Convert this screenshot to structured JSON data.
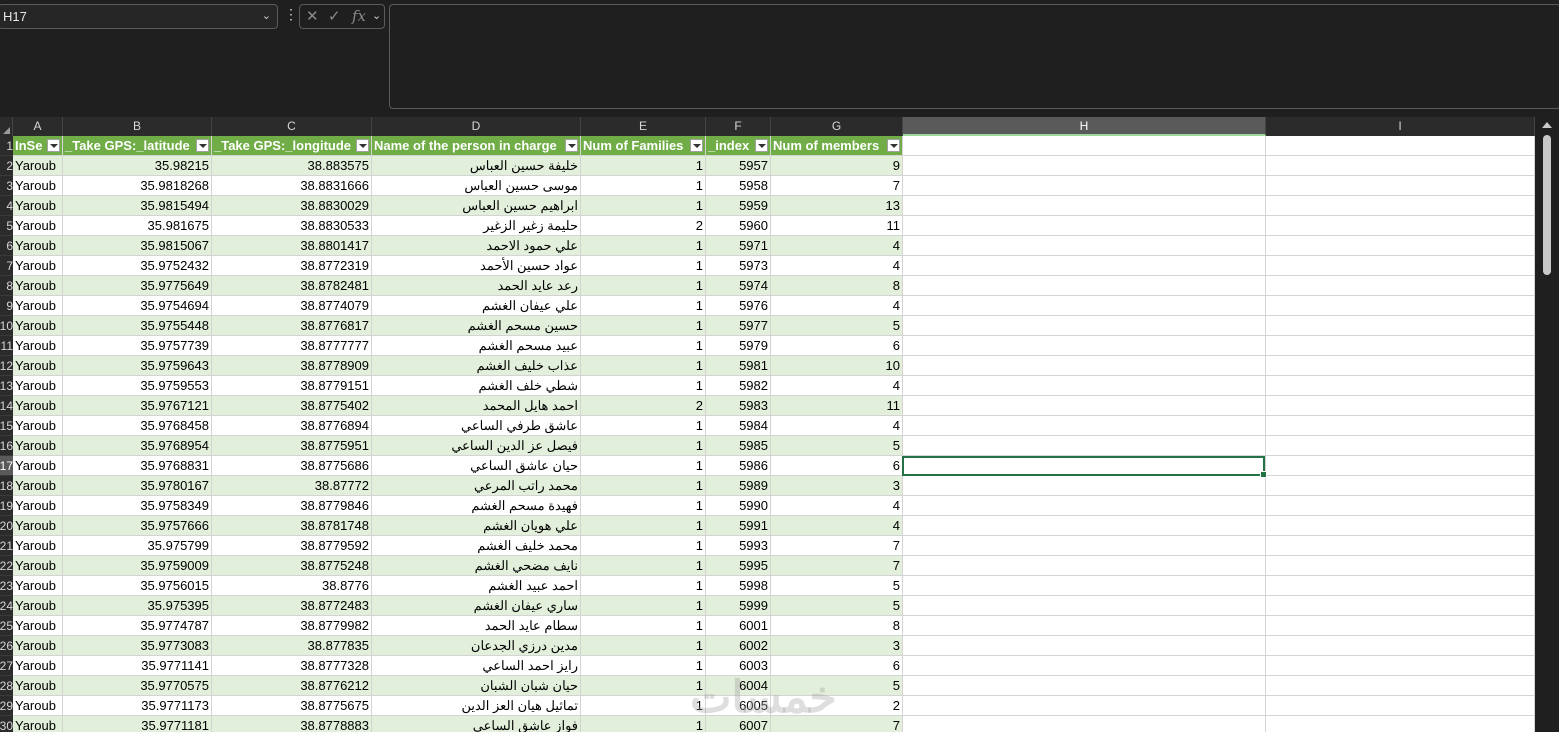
{
  "formula_bar": {
    "name_box": "H17",
    "fx_label": "fx",
    "formula": ""
  },
  "columns": [
    {
      "letter": "A",
      "w": 50
    },
    {
      "letter": "B",
      "w": 149
    },
    {
      "letter": "C",
      "w": 160
    },
    {
      "letter": "D",
      "w": 209
    },
    {
      "letter": "E",
      "w": 125
    },
    {
      "letter": "F",
      "w": 65
    },
    {
      "letter": "G",
      "w": 132
    },
    {
      "letter": "H",
      "w": 363
    },
    {
      "letter": "I",
      "w": 269
    }
  ],
  "selected_column": "H",
  "selected_row": "17",
  "headers": [
    "InSe",
    "_Take GPS:_latitude",
    "_Take GPS:_longitude",
    "Name of the person in charge",
    "Num of Families",
    "_index",
    "Num of members"
  ],
  "rows": [
    {
      "r": "1"
    },
    {
      "r": "2",
      "A": "Yaroub",
      "B": "35.98215",
      "C": "38.883575",
      "D": "خليفة حسين العباس",
      "E": "1",
      "F": "5957",
      "G": "9"
    },
    {
      "r": "3",
      "A": "Yaroub",
      "B": "35.9818268",
      "C": "38.8831666",
      "D": "موسى حسين العباس",
      "E": "1",
      "F": "5958",
      "G": "7"
    },
    {
      "r": "4",
      "A": "Yaroub",
      "B": "35.9815494",
      "C": "38.8830029",
      "D": "ابراهيم حسين العباس",
      "E": "1",
      "F": "5959",
      "G": "13"
    },
    {
      "r": "5",
      "A": "Yaroub",
      "B": "35.981675",
      "C": "38.8830533",
      "D": "حليمة زغير الزغير",
      "E": "2",
      "F": "5960",
      "G": "11"
    },
    {
      "r": "6",
      "A": "Yaroub",
      "B": "35.9815067",
      "C": "38.8801417",
      "D": "علي حمود الاحمد",
      "E": "1",
      "F": "5971",
      "G": "4"
    },
    {
      "r": "7",
      "A": "Yaroub",
      "B": "35.9752432",
      "C": "38.8772319",
      "D": "عواد حسين الأحمد",
      "E": "1",
      "F": "5973",
      "G": "4"
    },
    {
      "r": "8",
      "A": "Yaroub",
      "B": "35.9775649",
      "C": "38.8782481",
      "D": "رعد عايد الحمد",
      "E": "1",
      "F": "5974",
      "G": "8"
    },
    {
      "r": "9",
      "A": "Yaroub",
      "B": "35.9754694",
      "C": "38.8774079",
      "D": "علي عيفان الغشم",
      "E": "1",
      "F": "5976",
      "G": "4"
    },
    {
      "r": "10",
      "A": "Yaroub",
      "B": "35.9755448",
      "C": "38.8776817",
      "D": "حسين مسحم الغشم",
      "E": "1",
      "F": "5977",
      "G": "5"
    },
    {
      "r": "11",
      "A": "Yaroub",
      "B": "35.9757739",
      "C": "38.8777777",
      "D": "عبيد مسحم الغشم",
      "E": "1",
      "F": "5979",
      "G": "6"
    },
    {
      "r": "12",
      "A": "Yaroub",
      "B": "35.9759643",
      "C": "38.8778909",
      "D": "عذاب خليف الغشم",
      "E": "1",
      "F": "5981",
      "G": "10"
    },
    {
      "r": "13",
      "A": "Yaroub",
      "B": "35.9759553",
      "C": "38.8779151",
      "D": "شطي خلف الغشم",
      "E": "1",
      "F": "5982",
      "G": "4"
    },
    {
      "r": "14",
      "A": "Yaroub",
      "B": "35.9767121",
      "C": "38.8775402",
      "D": "احمد هايل المحمد",
      "E": "2",
      "F": "5983",
      "G": "11"
    },
    {
      "r": "15",
      "A": "Yaroub",
      "B": "35.9768458",
      "C": "38.8776894",
      "D": "عاشق طرفي الساعي",
      "E": "1",
      "F": "5984",
      "G": "4"
    },
    {
      "r": "16",
      "A": "Yaroub",
      "B": "35.9768954",
      "C": "38.8775951",
      "D": "فيصل عز الدين الساعي",
      "E": "1",
      "F": "5985",
      "G": "5"
    },
    {
      "r": "17",
      "A": "Yaroub",
      "B": "35.9768831",
      "C": "38.8775686",
      "D": "حيان عاشق الساعي",
      "E": "1",
      "F": "5986",
      "G": "6"
    },
    {
      "r": "18",
      "A": "Yaroub",
      "B": "35.9780167",
      "C": "38.87772",
      "D": "محمد راتب المرعي",
      "E": "1",
      "F": "5989",
      "G": "3"
    },
    {
      "r": "19",
      "A": "Yaroub",
      "B": "35.9758349",
      "C": "38.8779846",
      "D": "فهيدة مسحم الغشم",
      "E": "1",
      "F": "5990",
      "G": "4"
    },
    {
      "r": "20",
      "A": "Yaroub",
      "B": "35.9757666",
      "C": "38.8781748",
      "D": "علي هويان الغشم",
      "E": "1",
      "F": "5991",
      "G": "4"
    },
    {
      "r": "21",
      "A": "Yaroub",
      "B": "35.975799",
      "C": "38.8779592",
      "D": "محمد خليف الغشم",
      "E": "1",
      "F": "5993",
      "G": "7"
    },
    {
      "r": "22",
      "A": "Yaroub",
      "B": "35.9759009",
      "C": "38.8775248",
      "D": "نايف مضحي الغشم",
      "E": "1",
      "F": "5995",
      "G": "7"
    },
    {
      "r": "23",
      "A": "Yaroub",
      "B": "35.9756015",
      "C": "38.8776",
      "D": "احمد عبيد الغشم",
      "E": "1",
      "F": "5998",
      "G": "5"
    },
    {
      "r": "24",
      "A": "Yaroub",
      "B": "35.975395",
      "C": "38.8772483",
      "D": "ساري عيفان الغشم",
      "E": "1",
      "F": "5999",
      "G": "5"
    },
    {
      "r": "25",
      "A": "Yaroub",
      "B": "35.9774787",
      "C": "38.8779982",
      "D": "سطام عايد الحمد",
      "E": "1",
      "F": "6001",
      "G": "8"
    },
    {
      "r": "26",
      "A": "Yaroub",
      "B": "35.9773083",
      "C": "38.877835",
      "D": "مدين درزي الجدعان",
      "E": "1",
      "F": "6002",
      "G": "3"
    },
    {
      "r": "27",
      "A": "Yaroub",
      "B": "35.9771141",
      "C": "38.8777328",
      "D": "رايز احمد الساعي",
      "E": "1",
      "F": "6003",
      "G": "6"
    },
    {
      "r": "28",
      "A": "Yaroub",
      "B": "35.9770575",
      "C": "38.8776212",
      "D": "حيان شبان الشبان",
      "E": "1",
      "F": "6004",
      "G": "5"
    },
    {
      "r": "29",
      "A": "Yaroub",
      "B": "35.9771173",
      "C": "38.8775675",
      "D": "تماثيل هيان العز الدين",
      "E": "1",
      "F": "6005",
      "G": "2"
    },
    {
      "r": "30",
      "A": "Yaroub",
      "B": "35.9771181",
      "C": "38.8778883",
      "D": "فواز عاشق الساعي",
      "E": "1",
      "F": "6007",
      "G": "7"
    }
  ],
  "watermark": "خمسات",
  "colors": {
    "header_green": "#70ad47",
    "band_green": "#e2efda",
    "selection": "#217346"
  }
}
